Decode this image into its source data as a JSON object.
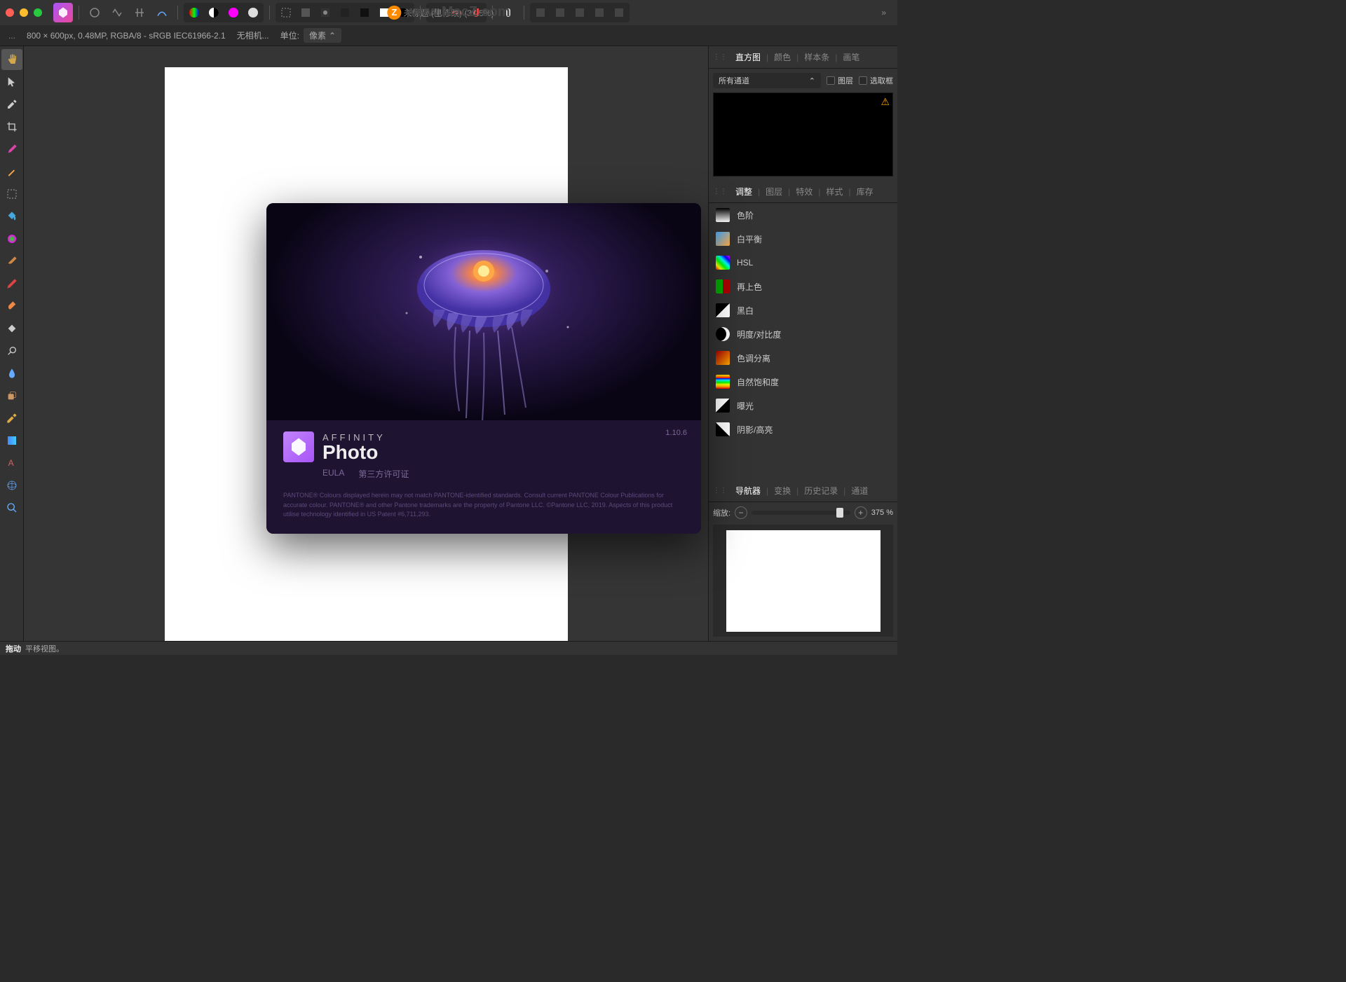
{
  "watermark": {
    "letter": "Z",
    "text": "www.MacZ.com"
  },
  "titlebar": {
    "title": "未标题 (已修改) (37.5%)"
  },
  "infobar": {
    "menu_dots": "...",
    "dimensions": "800 × 600px, 0.48MP, RGBA/8 - sRGB IEC61966-2.1",
    "no_camera": "无相机...",
    "units_label": "单位:",
    "units_value": "像素"
  },
  "tools": [
    "hand",
    "arrow",
    "eyedropper",
    "crop",
    "brush",
    "magic-wand",
    "marquee",
    "fill",
    "adjust",
    "paint",
    "healing",
    "smudge",
    "patch",
    "dodge",
    "blur",
    "stamp",
    "pen",
    "gradient",
    "text",
    "mesh",
    "zoom"
  ],
  "rightPanels": {
    "histogramTabs": [
      "直方图",
      "颜色",
      "样本条",
      "画笔"
    ],
    "activeHistogramTab": 0,
    "channelDropdown": "所有通道",
    "layerCheck": "图层",
    "selectionCheck": "选取框",
    "adjustmentTabs": [
      "调整",
      "图层",
      "特效",
      "样式",
      "库存"
    ],
    "activeAdjustmentTab": 0,
    "adjustments": [
      {
        "label": "色阶",
        "icon": "levels"
      },
      {
        "label": "白平衡",
        "icon": "whitebalance"
      },
      {
        "label": "HSL",
        "icon": "hsl"
      },
      {
        "label": "再上色",
        "icon": "recolor"
      },
      {
        "label": "黑白",
        "icon": "blackwhite"
      },
      {
        "label": "明度/对比度",
        "icon": "brightness"
      },
      {
        "label": "色调分离",
        "icon": "posterize"
      },
      {
        "label": "自然饱和度",
        "icon": "vibrance"
      },
      {
        "label": "曝光",
        "icon": "exposure"
      },
      {
        "label": "阴影/高亮",
        "icon": "shadows"
      }
    ],
    "navigatorTabs": [
      "导航器",
      "变换",
      "历史记录",
      "通道"
    ],
    "activeNavigatorTab": 0,
    "zoomLabel": "缩放:",
    "zoomValue": "375 %"
  },
  "aboutDialog": {
    "brandTop": "AFFINITY",
    "brandName": "Photo",
    "version": "1.10.6",
    "eula": "EULA",
    "thirdParty": "第三方许可证",
    "legal": "PANTONE® Colours displayed herein may not match PANTONE-identified standards. Consult current PANTONE Colour Publications for accurate colour. PANTONE® and other Pantone trademarks are the property of Pantone LLC. ©Pantone LLC, 2019. Aspects of this product utilise technology identified in US Patent #6,711,293."
  },
  "statusbar": {
    "action": "拖动",
    "hint": "平移视图。"
  }
}
